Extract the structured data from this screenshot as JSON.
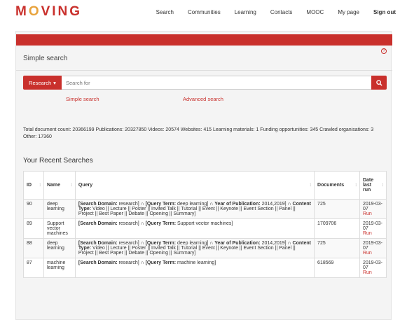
{
  "logo": {
    "m": "M",
    "o": "O",
    "rest": "VING"
  },
  "nav": [
    "Search",
    "Communities",
    "Learning",
    "Contacts",
    "MOOC",
    "My page",
    "Sign out"
  ],
  "panel": {
    "title": "Simple search",
    "help": "?"
  },
  "search": {
    "dropdown_label": "Research",
    "placeholder": "Search for",
    "simple_link": "Simple search",
    "advanced_link": "Advanced search"
  },
  "counts": "Total document count: 20366199 Publications: 20327850 Videos: 20574 Websites: 415 Learning materials: 1 Funding opportunities: 345 Crawled organisations: 3 Other: 17360",
  "recent": {
    "title": "Your Recent Searches",
    "headers": {
      "id": "ID",
      "name": "Name",
      "query": "Query",
      "documents": "Documents",
      "date": "Date last run"
    },
    "rows": [
      {
        "id": "90",
        "name": "deep learning",
        "query_parts": [
          [
            "b",
            "[Search Domain:"
          ],
          [
            "t",
            " research] ∩ "
          ],
          [
            "b",
            "[Query Term:"
          ],
          [
            "t",
            " deep learning] ∩ "
          ],
          [
            "b",
            "Year of Publication:"
          ],
          [
            "t",
            " 2014,2019] ∩ "
          ],
          [
            "b",
            "Content Type:"
          ],
          [
            "t",
            " Video || Lecture || Poster || Invited Talk || Tutorial || Event || Keynote || Event Section || Panel || Project || Best Paper || Debate || Opening || Summary]"
          ]
        ],
        "documents": "725",
        "date": "2019-03-07",
        "run": "Run"
      },
      {
        "id": "89",
        "name": "Support vector machines",
        "query_parts": [
          [
            "b",
            "[Search Domain:"
          ],
          [
            "t",
            " research] ∩ "
          ],
          [
            "b",
            "[Query Term:"
          ],
          [
            "t",
            " Support vector machines]"
          ]
        ],
        "documents": "1709706",
        "date": "2019-03-07",
        "run": "Run"
      },
      {
        "id": "88",
        "name": "deep learning",
        "query_parts": [
          [
            "b",
            "[Search Domain:"
          ],
          [
            "t",
            " research] ∩ "
          ],
          [
            "b",
            "[Query Term:"
          ],
          [
            "t",
            " deep learning] ∩ "
          ],
          [
            "b",
            "Year of Publication:"
          ],
          [
            "t",
            " 2014,2019] ∩ "
          ],
          [
            "b",
            "Content Type:"
          ],
          [
            "t",
            " Video || Lecture || Poster || Invited Talk || Tutorial || Event || Keynote || Event Section || Panel || Project || Best Paper || Debate || Opening || Summary]"
          ]
        ],
        "documents": "725",
        "date": "2019-03-07",
        "run": "Run"
      },
      {
        "id": "87",
        "name": "machine learning",
        "query_parts": [
          [
            "b",
            "[Search Domain:"
          ],
          [
            "t",
            " research] ∩ "
          ],
          [
            "b",
            "[Query Term:"
          ],
          [
            "t",
            " machine learning]"
          ]
        ],
        "documents": "618569",
        "date": "2019-03-07",
        "run": "Run"
      }
    ]
  },
  "icons": {
    "search": "search-icon",
    "caret": "caret-down-icon",
    "sort": "sort-icon",
    "help": "help-icon"
  },
  "colors": {
    "accent": "#c9302c",
    "logo_o": "#e8a33d"
  }
}
